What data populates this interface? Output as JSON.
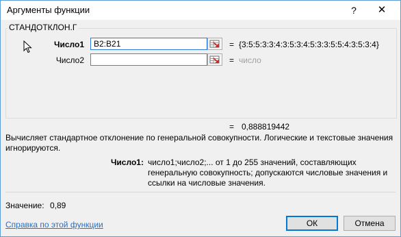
{
  "window": {
    "title": "Аргументы функции",
    "help_glyph": "?",
    "close_glyph": "✕"
  },
  "function": {
    "name": "СТАНДОТКЛОН.Г"
  },
  "args": [
    {
      "label": "Число1",
      "bold": true,
      "input_value": "B2:B21",
      "result_eq": "=",
      "result": "{3:5:5:3:3:4:3:5:3:4:5:3:3:5:5:4:3:5:3:4}"
    },
    {
      "label": "Число2",
      "bold": false,
      "input_value": "",
      "result_eq": "=",
      "result": "число"
    }
  ],
  "formula_result": {
    "eq": "=",
    "value": "0,888819442"
  },
  "description": "Вычисляет стандартное отклонение по генеральной совокупности. Логические и текстовые значения игнорируются.",
  "param_help": {
    "label": "Число1:",
    "text": "число1;число2;... от 1 до 255 значений, составляющих генеральную совокупность; допускаются числовые значения и ссылки на числовые значения."
  },
  "value_row": {
    "label": "Значение:",
    "value": "0,89"
  },
  "help_link": "Справка по этой функции",
  "buttons": {
    "ok": "ОК",
    "cancel": "Отмена"
  },
  "colors": {
    "window_border": "#5b9bd5",
    "link": "#2b6fc0",
    "default_button_border": "#0078d7"
  }
}
